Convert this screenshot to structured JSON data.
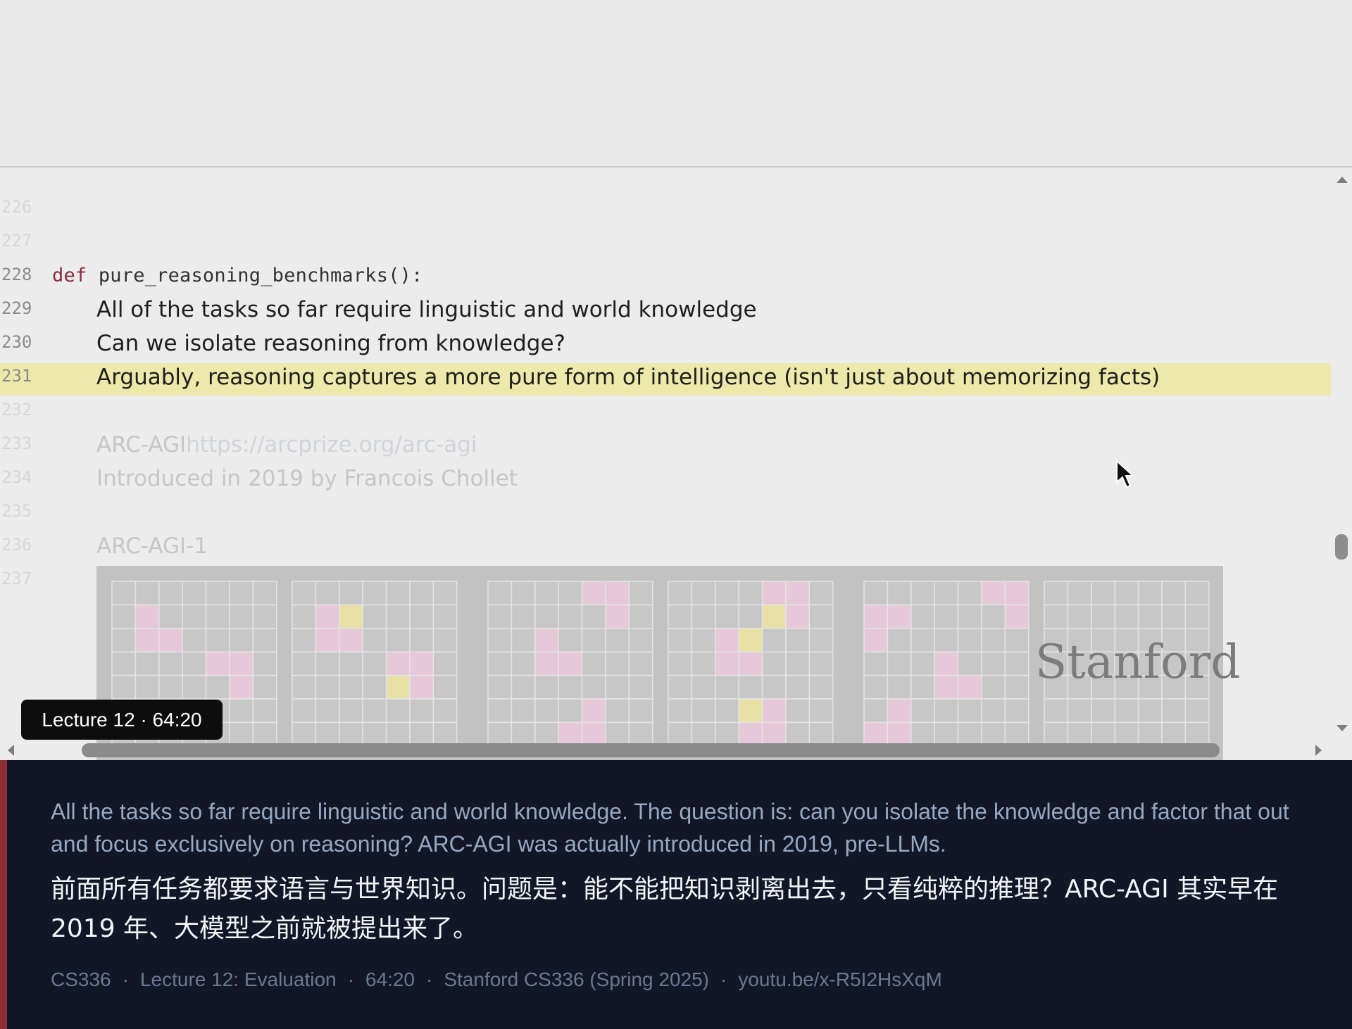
{
  "editor": {
    "lines": [
      {
        "num": "226",
        "text": ""
      },
      {
        "num": "227",
        "text": ""
      },
      {
        "num": "228",
        "keyword": "def",
        "code": " pure_reasoning_benchmarks():"
      },
      {
        "num": "229",
        "text": "All of the tasks so far require linguistic and world knowledge"
      },
      {
        "num": "230",
        "text": "Can we isolate reasoning from knowledge?"
      },
      {
        "num": "231",
        "text": "Arguably, reasoning captures a more pure form of intelligence (isn't just about memorizing facts)"
      },
      {
        "num": "232",
        "text": ""
      },
      {
        "num": "233",
        "text": "ARC-AGI",
        "link": "https://arcprize.org/arc-agi"
      },
      {
        "num": "234",
        "text": "Introduced in 2019 by Francois Chollet"
      },
      {
        "num": "235",
        "text": ""
      },
      {
        "num": "236",
        "text": "ARC-AGI-1"
      },
      {
        "num": "237",
        "text": ""
      }
    ],
    "highlighted_line": "231",
    "watermark": "Stanford",
    "colors": {
      "highlight": "#ece9aa",
      "keyword": "#8b2c3d",
      "pink_cell": "#e7c8d8",
      "yellow_cell": "#e7e1a6"
    }
  },
  "badge": {
    "label": "Lecture 12 · 64:20"
  },
  "caption": {
    "english": "All the tasks so far require linguistic and world knowledge. The question is: can you isolate the knowledge and factor that out and focus exclusively on reasoning? ARC-AGI was actually introduced in 2019, pre-LLMs.",
    "chinese": "前面所有任务都要求语言与世界知识。问题是：能不能把知识剥离出去，只看纯粹的推理？ARC-AGI 其实早在 2019 年、大模型之前就被提出来了。",
    "meta": [
      "CS336",
      "Lecture 12: Evaluation",
      "64:20",
      "Stanford CS336 (Spring 2025)",
      "youtu.be/x-R5I2HsXqM"
    ]
  },
  "icons": [
    "cursor-arrow-icon",
    "scroll-up-arrow-icon",
    "scroll-down-arrow-icon",
    "scroll-left-arrow-icon",
    "scroll-right-arrow-icon"
  ]
}
